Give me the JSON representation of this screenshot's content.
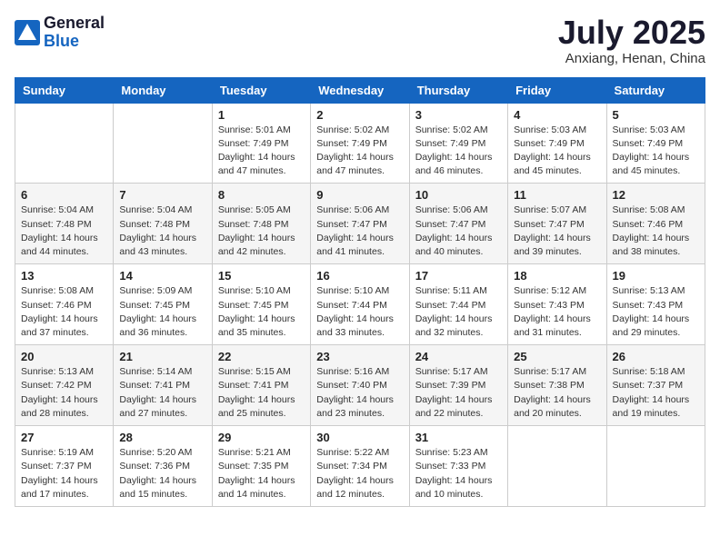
{
  "header": {
    "logo_general": "General",
    "logo_blue": "Blue",
    "month_year": "July 2025",
    "location": "Anxiang, Henan, China"
  },
  "weekdays": [
    "Sunday",
    "Monday",
    "Tuesday",
    "Wednesday",
    "Thursday",
    "Friday",
    "Saturday"
  ],
  "weeks": [
    [
      {
        "day": "",
        "info": ""
      },
      {
        "day": "",
        "info": ""
      },
      {
        "day": "1",
        "info": "Sunrise: 5:01 AM\nSunset: 7:49 PM\nDaylight: 14 hours and 47 minutes."
      },
      {
        "day": "2",
        "info": "Sunrise: 5:02 AM\nSunset: 7:49 PM\nDaylight: 14 hours and 47 minutes."
      },
      {
        "day": "3",
        "info": "Sunrise: 5:02 AM\nSunset: 7:49 PM\nDaylight: 14 hours and 46 minutes."
      },
      {
        "day": "4",
        "info": "Sunrise: 5:03 AM\nSunset: 7:49 PM\nDaylight: 14 hours and 45 minutes."
      },
      {
        "day": "5",
        "info": "Sunrise: 5:03 AM\nSunset: 7:49 PM\nDaylight: 14 hours and 45 minutes."
      }
    ],
    [
      {
        "day": "6",
        "info": "Sunrise: 5:04 AM\nSunset: 7:48 PM\nDaylight: 14 hours and 44 minutes."
      },
      {
        "day": "7",
        "info": "Sunrise: 5:04 AM\nSunset: 7:48 PM\nDaylight: 14 hours and 43 minutes."
      },
      {
        "day": "8",
        "info": "Sunrise: 5:05 AM\nSunset: 7:48 PM\nDaylight: 14 hours and 42 minutes."
      },
      {
        "day": "9",
        "info": "Sunrise: 5:06 AM\nSunset: 7:47 PM\nDaylight: 14 hours and 41 minutes."
      },
      {
        "day": "10",
        "info": "Sunrise: 5:06 AM\nSunset: 7:47 PM\nDaylight: 14 hours and 40 minutes."
      },
      {
        "day": "11",
        "info": "Sunrise: 5:07 AM\nSunset: 7:47 PM\nDaylight: 14 hours and 39 minutes."
      },
      {
        "day": "12",
        "info": "Sunrise: 5:08 AM\nSunset: 7:46 PM\nDaylight: 14 hours and 38 minutes."
      }
    ],
    [
      {
        "day": "13",
        "info": "Sunrise: 5:08 AM\nSunset: 7:46 PM\nDaylight: 14 hours and 37 minutes."
      },
      {
        "day": "14",
        "info": "Sunrise: 5:09 AM\nSunset: 7:45 PM\nDaylight: 14 hours and 36 minutes."
      },
      {
        "day": "15",
        "info": "Sunrise: 5:10 AM\nSunset: 7:45 PM\nDaylight: 14 hours and 35 minutes."
      },
      {
        "day": "16",
        "info": "Sunrise: 5:10 AM\nSunset: 7:44 PM\nDaylight: 14 hours and 33 minutes."
      },
      {
        "day": "17",
        "info": "Sunrise: 5:11 AM\nSunset: 7:44 PM\nDaylight: 14 hours and 32 minutes."
      },
      {
        "day": "18",
        "info": "Sunrise: 5:12 AM\nSunset: 7:43 PM\nDaylight: 14 hours and 31 minutes."
      },
      {
        "day": "19",
        "info": "Sunrise: 5:13 AM\nSunset: 7:43 PM\nDaylight: 14 hours and 29 minutes."
      }
    ],
    [
      {
        "day": "20",
        "info": "Sunrise: 5:13 AM\nSunset: 7:42 PM\nDaylight: 14 hours and 28 minutes."
      },
      {
        "day": "21",
        "info": "Sunrise: 5:14 AM\nSunset: 7:41 PM\nDaylight: 14 hours and 27 minutes."
      },
      {
        "day": "22",
        "info": "Sunrise: 5:15 AM\nSunset: 7:41 PM\nDaylight: 14 hours and 25 minutes."
      },
      {
        "day": "23",
        "info": "Sunrise: 5:16 AM\nSunset: 7:40 PM\nDaylight: 14 hours and 23 minutes."
      },
      {
        "day": "24",
        "info": "Sunrise: 5:17 AM\nSunset: 7:39 PM\nDaylight: 14 hours and 22 minutes."
      },
      {
        "day": "25",
        "info": "Sunrise: 5:17 AM\nSunset: 7:38 PM\nDaylight: 14 hours and 20 minutes."
      },
      {
        "day": "26",
        "info": "Sunrise: 5:18 AM\nSunset: 7:37 PM\nDaylight: 14 hours and 19 minutes."
      }
    ],
    [
      {
        "day": "27",
        "info": "Sunrise: 5:19 AM\nSunset: 7:37 PM\nDaylight: 14 hours and 17 minutes."
      },
      {
        "day": "28",
        "info": "Sunrise: 5:20 AM\nSunset: 7:36 PM\nDaylight: 14 hours and 15 minutes."
      },
      {
        "day": "29",
        "info": "Sunrise: 5:21 AM\nSunset: 7:35 PM\nDaylight: 14 hours and 14 minutes."
      },
      {
        "day": "30",
        "info": "Sunrise: 5:22 AM\nSunset: 7:34 PM\nDaylight: 14 hours and 12 minutes."
      },
      {
        "day": "31",
        "info": "Sunrise: 5:23 AM\nSunset: 7:33 PM\nDaylight: 14 hours and 10 minutes."
      },
      {
        "day": "",
        "info": ""
      },
      {
        "day": "",
        "info": ""
      }
    ]
  ]
}
